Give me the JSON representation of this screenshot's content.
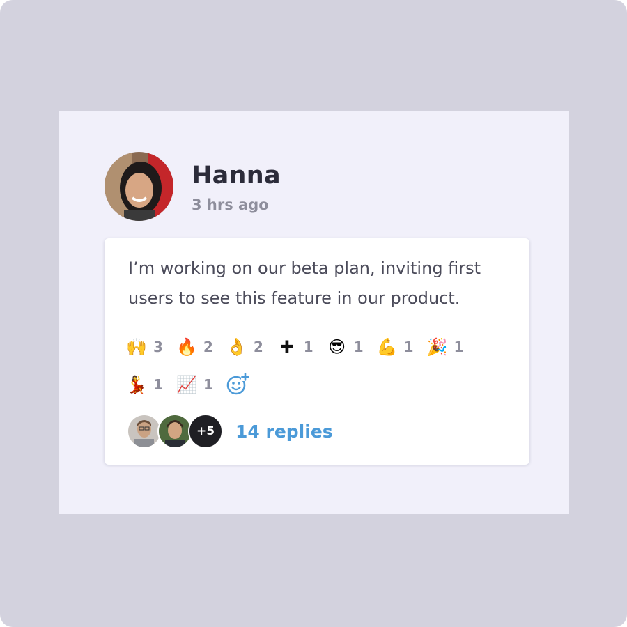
{
  "post": {
    "author": "Hanna",
    "time": "3 hrs ago",
    "message": "I’m working on our beta plan, inviting first users to see this feature in our product."
  },
  "reactions": [
    {
      "icon": "raising-hands-icon",
      "emoji": "🙌",
      "count": "3"
    },
    {
      "icon": "fire-icon",
      "emoji": "🔥",
      "count": "2"
    },
    {
      "icon": "ok-hand-icon",
      "emoji": "👌",
      "count": "2"
    },
    {
      "icon": "plus-icon",
      "emoji": "✚",
      "count": "1"
    },
    {
      "icon": "sunglasses-face-icon",
      "emoji": "😎",
      "count": "1"
    },
    {
      "icon": "flexed-biceps-icon",
      "emoji": "💪",
      "count": "1"
    },
    {
      "icon": "party-popper-icon",
      "emoji": "🎉",
      "count": "1"
    },
    {
      "icon": "dancer-icon",
      "emoji": "💃",
      "count": "1"
    },
    {
      "icon": "chart-increasing-icon",
      "emoji": "📈",
      "count": "1"
    }
  ],
  "replies": {
    "more_count": "+5",
    "label": "14 replies"
  },
  "colors": {
    "outer_bg": "#d3d2de",
    "panel_bg": "#f1f0fa",
    "link": "#4b9ad8",
    "muted": "#8e8e9c",
    "text": "#4b4b5a"
  }
}
